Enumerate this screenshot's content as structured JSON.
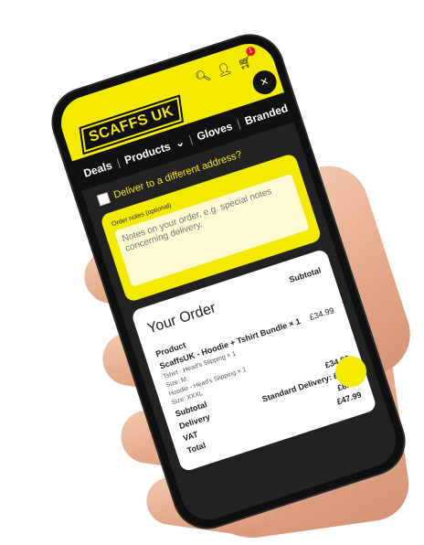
{
  "header": {
    "logo": "SCAFFS UK",
    "cart_count": "1",
    "icons": [
      "search-icon",
      "account-icon",
      "cart-icon",
      "close-icon"
    ]
  },
  "nav": {
    "items": [
      "Deals",
      "Products",
      "Gloves",
      "Branded"
    ]
  },
  "checkout": {
    "different_address_label": "Deliver to a different address?",
    "order_notes_label": "Order notes (optional)",
    "order_notes_placeholder": "Notes on your order, e.g. special notes concerning delivery."
  },
  "order": {
    "title": "Your Order",
    "product_header": "Product",
    "subtotal_header": "Subtotal",
    "product_name": "ScaffsUK - Hoodie + Tshirt Bundle × 1",
    "product_subtotal": "£34.99",
    "item1": "Tshirt - Head's Slipping × 1",
    "item1_size": "Size: M",
    "item2": "Hoodie - Head's Slipping × 1",
    "item2_size": "Size: XXXL",
    "subtotal_label": "Subtotal",
    "subtotal_value": "£34.99",
    "delivery_label": "Delivery",
    "delivery_value": "Standard Delivery: £5.00",
    "vat_label": "VAT",
    "vat_value": "£8.00",
    "total_label": "Total",
    "total_value": "£47.99"
  },
  "colors": {
    "brand_yellow": "#f4ea00",
    "dark": "#111111"
  }
}
